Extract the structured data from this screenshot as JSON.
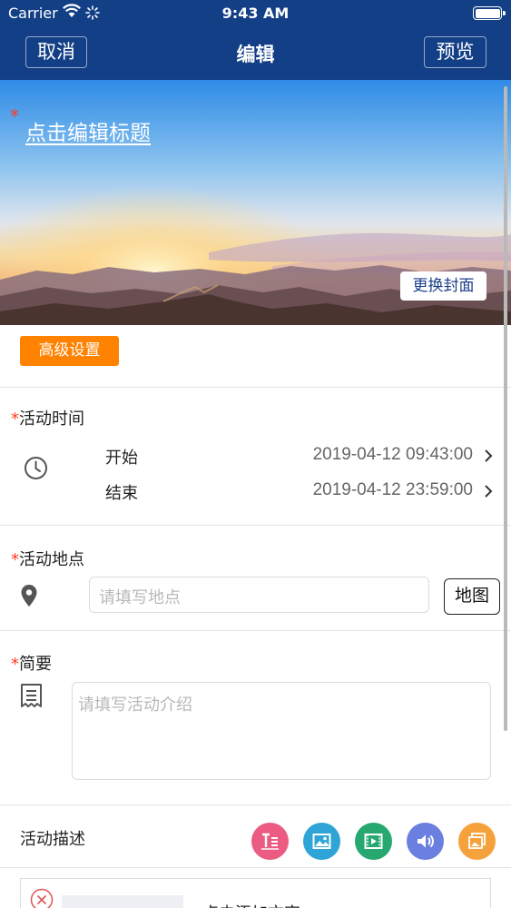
{
  "status_bar": {
    "carrier": "Carrier",
    "time": "9:43 AM"
  },
  "nav": {
    "cancel": "取消",
    "title": "编辑",
    "preview": "预览"
  },
  "cover": {
    "required_mark": "*",
    "title_placeholder": "点击编辑标题",
    "change_cover": "更换封面"
  },
  "advanced_settings": "高级设置",
  "time_section": {
    "label": "活动时间",
    "start_label": "开始",
    "start_value": "2019-04-12 09:43:00",
    "end_label": "结束",
    "end_value": "2019-04-12 23:59:00"
  },
  "location_section": {
    "label": "活动地点",
    "placeholder": "请填写地点",
    "map_button": "地图"
  },
  "summary_section": {
    "label": "简要",
    "placeholder": "请填写活动介绍"
  },
  "description_section": {
    "label": "活动描述",
    "tools": [
      {
        "icon": "text-icon",
        "color": "#ec5b82"
      },
      {
        "icon": "image-icon",
        "color": "#2fa4d6"
      },
      {
        "icon": "video-icon",
        "color": "#26a870"
      },
      {
        "icon": "audio-icon",
        "color": "#6b7fe0"
      },
      {
        "icon": "gallery-icon",
        "color": "#f5a23c"
      }
    ]
  },
  "text_block": {
    "text": "点击添加文字"
  },
  "colors": {
    "nav_bg": "#133f86",
    "accent_orange": "#ff8200",
    "required": "#ff3b1d"
  }
}
